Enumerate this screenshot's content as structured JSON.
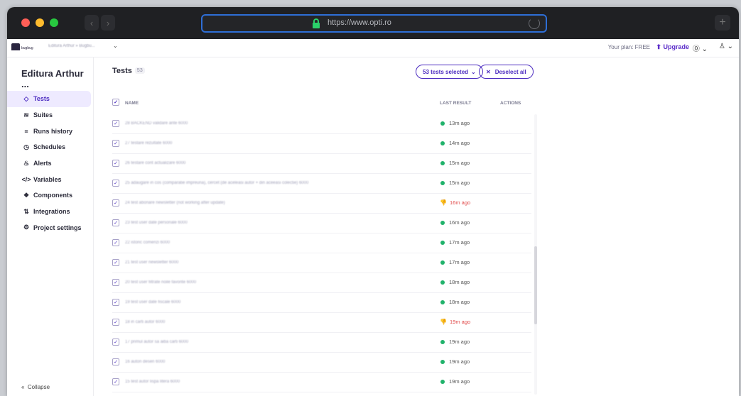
{
  "browser": {
    "url": "https://www.opti.ro",
    "back_glyph": "‹",
    "forward_glyph": "›",
    "newtab_glyph": "+"
  },
  "topbar": {
    "logo_text": "bugbug",
    "project_selector": "Editura Arthur » Bugbu...",
    "project_chevron": "⌄",
    "plan_text": "Your plan: FREE",
    "upgrade_label": "Upgrade",
    "upgrade_icon": "⬆",
    "help_icon": "⓪ ⌄",
    "user_icon": "♙ ⌄"
  },
  "sidebar": {
    "title": "Editura Arthur ...",
    "items": [
      {
        "label": "Tests",
        "icon": "◇",
        "active": true
      },
      {
        "label": "Suites",
        "icon": "≋"
      },
      {
        "label": "Runs history",
        "icon": "≡"
      },
      {
        "label": "Schedules",
        "icon": "◷"
      },
      {
        "label": "Alerts",
        "icon": "♨"
      },
      {
        "label": "Variables",
        "icon": "</>"
      },
      {
        "label": "Components",
        "icon": "❖"
      },
      {
        "label": "Integrations",
        "icon": "⇅"
      },
      {
        "label": "Project settings",
        "icon": "⚙"
      }
    ],
    "collapse_label": "Collapse",
    "collapse_icon": "«"
  },
  "main": {
    "heading": "Tests",
    "count": "53",
    "selected_button": "53 tests selected",
    "selected_chevron": "⌄",
    "deselect_button": "Deselect all",
    "deselect_icon": "✕",
    "columns": {
      "name": "NAME",
      "last_result": "LAST RESULT",
      "actions": "ACTIONS"
    },
    "check_glyph": "✓",
    "rows": [
      {
        "name": "28 BACKEND validare ante 6000",
        "result": "13m ago",
        "status": "passed"
      },
      {
        "name": "27 testare rezultate 6000",
        "result": "14m ago",
        "status": "passed"
      },
      {
        "name": "26 testare cont actualizare 6000",
        "result": "15m ago",
        "status": "passed"
      },
      {
        "name": "25 adaugare in cos (comparatie impreuna), cercet (de aceleasi autor + din aceeasi colectie) 6000",
        "result": "15m ago",
        "status": "passed"
      },
      {
        "name": "24 test abonare newsletter (not working after update)",
        "result": "16m ago",
        "status": "failed"
      },
      {
        "name": "23 test user date personale 6000",
        "result": "16m ago",
        "status": "passed"
      },
      {
        "name": "22 istoric comenzi 6000",
        "result": "17m ago",
        "status": "passed"
      },
      {
        "name": "21 test user newsletter 6000",
        "result": "17m ago",
        "status": "passed"
      },
      {
        "name": "20 test user filtrate noile favorite 6000",
        "result": "18m ago",
        "status": "passed"
      },
      {
        "name": "19 test user date fiscale 6000",
        "result": "18m ago",
        "status": "passed"
      },
      {
        "name": "18 in carti autor 6000",
        "result": "19m ago",
        "status": "failed"
      },
      {
        "name": "17 primul autor sa aiba carti 6000",
        "result": "19m ago",
        "status": "passed"
      },
      {
        "name": "16 autori desen 6000",
        "result": "19m ago",
        "status": "passed"
      },
      {
        "name": "15 test autor lispa litera 6000",
        "result": "19m ago",
        "status": "passed"
      }
    ]
  },
  "colors": {
    "accent": "#4b2bc0",
    "passed": "#20b26b",
    "failed": "#e04848"
  }
}
